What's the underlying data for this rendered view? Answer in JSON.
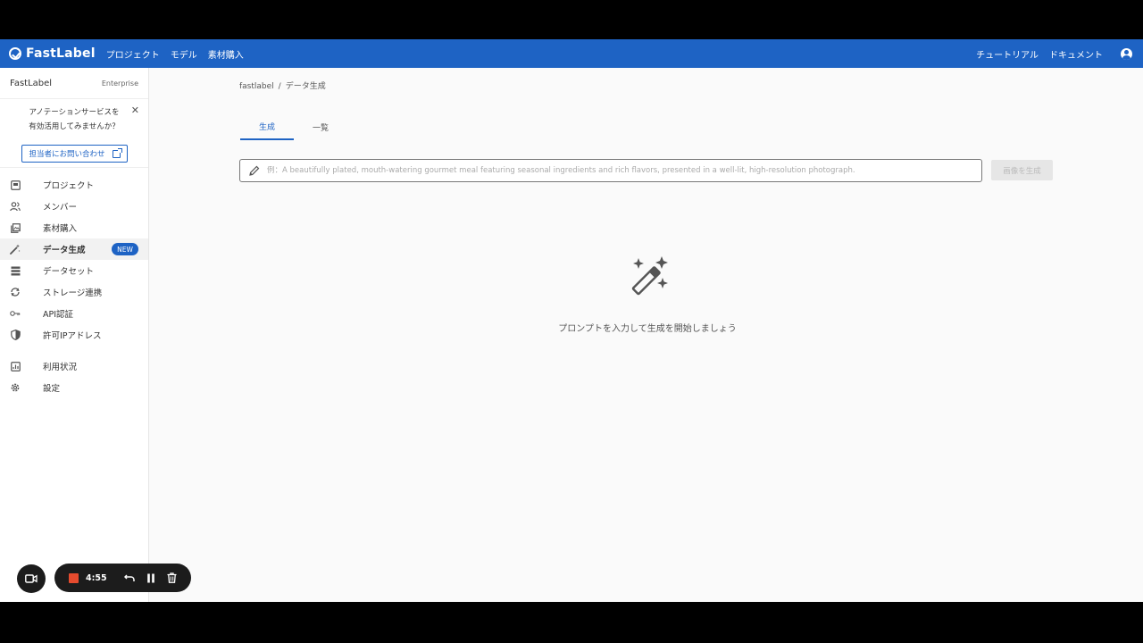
{
  "header": {
    "logo_text": "FastLabel",
    "nav": [
      "プロジェクト",
      "モデル",
      "素材購入"
    ],
    "right_links": [
      "チュートリアル",
      "ドキュメント"
    ]
  },
  "sidebar": {
    "org_name": "FastLabel",
    "plan": "Enterprise",
    "promo": {
      "line1": "アノテーションサービスを",
      "line2": "有効活用してみませんか？",
      "button_label": "担当者にお問い合わせ"
    },
    "items": [
      {
        "label": "プロジェクト",
        "icon": "project-icon"
      },
      {
        "label": "メンバー",
        "icon": "members-icon"
      },
      {
        "label": "素材購入",
        "icon": "material-icon"
      },
      {
        "label": "データ生成",
        "icon": "magic-wand-icon",
        "active": true,
        "badge": "NEW"
      },
      {
        "label": "データセット",
        "icon": "dataset-icon"
      },
      {
        "label": "ストレージ連携",
        "icon": "storage-sync-icon"
      },
      {
        "label": "API認証",
        "icon": "api-key-icon"
      },
      {
        "label": "許可IPアドレス",
        "icon": "shield-icon"
      },
      {
        "label": "利用状況",
        "icon": "usage-chart-icon"
      },
      {
        "label": "設定",
        "icon": "gear-icon"
      }
    ]
  },
  "breadcrumb": {
    "root": "fastlabel",
    "separator": "/",
    "current": "データ生成"
  },
  "tabs": [
    {
      "label": "生成",
      "active": true
    },
    {
      "label": "一覧",
      "active": false
    }
  ],
  "prompt": {
    "value": "",
    "placeholder": "例：A beautifully plated, mouth-watering gourmet meal featuring seasonal ingredients and rich flavors, presented in a well-lit, high-resolution photograph."
  },
  "generate_button": "画像を生成",
  "empty_state": {
    "message": "プロンプトを入力して生成を開始しましょう"
  },
  "recorder": {
    "time": "4:55"
  },
  "colors": {
    "brand": "#1e63c4",
    "record": "#e64b2e"
  }
}
